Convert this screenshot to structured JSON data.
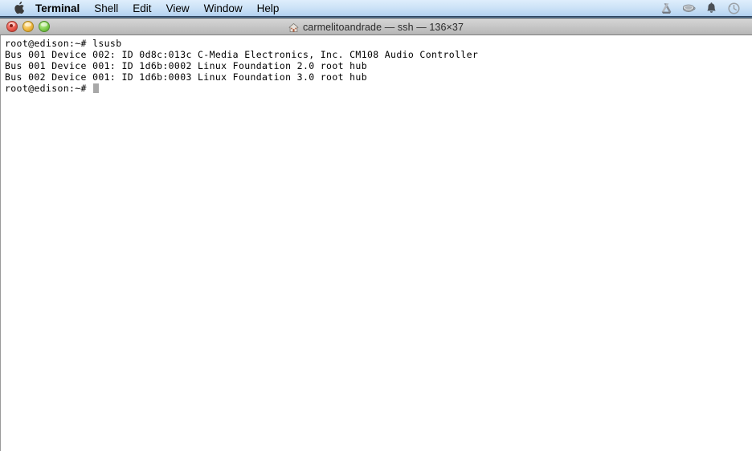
{
  "menubar": {
    "apple_icon": "apple-logo-icon",
    "items": [
      {
        "label": "Terminal",
        "bold": true
      },
      {
        "label": "Shell",
        "bold": false
      },
      {
        "label": "Edit",
        "bold": false
      },
      {
        "label": "View",
        "bold": false
      },
      {
        "label": "Window",
        "bold": false
      },
      {
        "label": "Help",
        "bold": false
      }
    ],
    "status_icons": [
      {
        "name": "google-drive-icon"
      },
      {
        "name": "coffee-cup-icon"
      },
      {
        "name": "bell-notification-icon"
      },
      {
        "name": "clock-history-icon"
      }
    ]
  },
  "window": {
    "title": "carmelitoandrade — ssh — 136×37",
    "home_icon": "home-icon",
    "controls": {
      "close": "close-button",
      "minimize": "minimize-button",
      "zoom": "zoom-button"
    }
  },
  "terminal": {
    "lines": [
      "root@edison:~# lsusb",
      "Bus 001 Device 002: ID 0d8c:013c C-Media Electronics, Inc. CM108 Audio Controller",
      "Bus 001 Device 001: ID 1d6b:0002 Linux Foundation 2.0 root hub",
      "Bus 002 Device 001: ID 1d6b:0003 Linux Foundation 3.0 root hub"
    ],
    "prompt": "root@edison:~# ",
    "cursor": "block-cursor"
  },
  "colors": {
    "menubar_top": "#dfeefc",
    "menubar_bottom": "#a9c9e8",
    "titlebar": "#c8c8c8",
    "terminal_bg": "#ffffff",
    "terminal_fg": "#000000",
    "cursor": "#a8a8a8",
    "close_red": "#e8564a",
    "minimize_yellow": "#f0b83f",
    "zoom_green": "#7fce4e"
  }
}
